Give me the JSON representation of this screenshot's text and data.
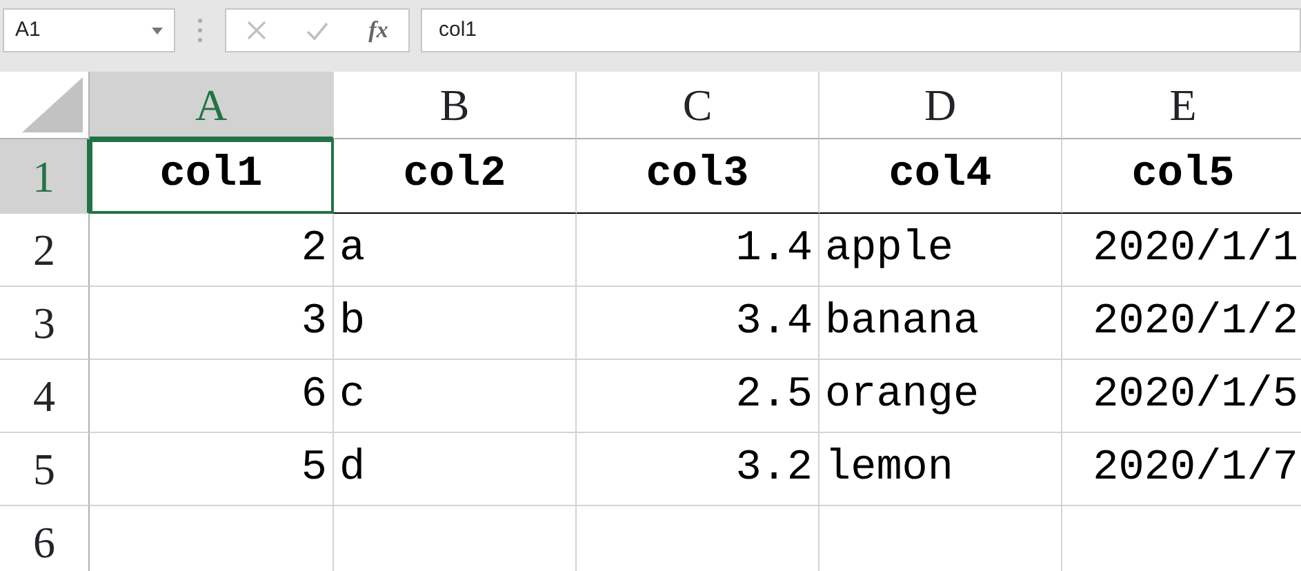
{
  "name_box": {
    "value": "A1"
  },
  "formula_bar": {
    "function_label": "fx",
    "value": "col1"
  },
  "columns": [
    {
      "label": "A",
      "selected": true
    },
    {
      "label": "B",
      "selected": false
    },
    {
      "label": "C",
      "selected": false
    },
    {
      "label": "D",
      "selected": false
    },
    {
      "label": "E",
      "selected": false
    }
  ],
  "rows": [
    {
      "header": "1",
      "selected": true,
      "cells": [
        {
          "text": "col1",
          "kind": "heading",
          "selected": true
        },
        {
          "text": "col2",
          "kind": "heading",
          "selected": false
        },
        {
          "text": "col3",
          "kind": "heading",
          "selected": false
        },
        {
          "text": "col4",
          "kind": "heading",
          "selected": false
        },
        {
          "text": "col5",
          "kind": "heading",
          "selected": false
        }
      ]
    },
    {
      "header": "2",
      "selected": false,
      "cells": [
        {
          "text": "2",
          "kind": "number",
          "selected": false
        },
        {
          "text": "a",
          "kind": "text",
          "selected": false
        },
        {
          "text": "1.4",
          "kind": "number",
          "selected": false
        },
        {
          "text": "apple",
          "kind": "text",
          "selected": false
        },
        {
          "text": "2020/1/1",
          "kind": "number",
          "selected": false
        }
      ]
    },
    {
      "header": "3",
      "selected": false,
      "cells": [
        {
          "text": "3",
          "kind": "number",
          "selected": false
        },
        {
          "text": "b",
          "kind": "text",
          "selected": false
        },
        {
          "text": "3.4",
          "kind": "number",
          "selected": false
        },
        {
          "text": "banana",
          "kind": "text",
          "selected": false
        },
        {
          "text": "2020/1/2",
          "kind": "number",
          "selected": false
        }
      ]
    },
    {
      "header": "4",
      "selected": false,
      "cells": [
        {
          "text": "6",
          "kind": "number",
          "selected": false
        },
        {
          "text": "c",
          "kind": "text",
          "selected": false
        },
        {
          "text": "2.5",
          "kind": "number",
          "selected": false
        },
        {
          "text": "orange",
          "kind": "text",
          "selected": false
        },
        {
          "text": "2020/1/5",
          "kind": "number",
          "selected": false
        }
      ]
    },
    {
      "header": "5",
      "selected": false,
      "cells": [
        {
          "text": "5",
          "kind": "number",
          "selected": false
        },
        {
          "text": "d",
          "kind": "text",
          "selected": false
        },
        {
          "text": "3.2",
          "kind": "number",
          "selected": false
        },
        {
          "text": "lemon",
          "kind": "text",
          "selected": false
        },
        {
          "text": "2020/1/7",
          "kind": "number",
          "selected": false
        }
      ]
    },
    {
      "header": "6",
      "selected": false
    }
  ]
}
